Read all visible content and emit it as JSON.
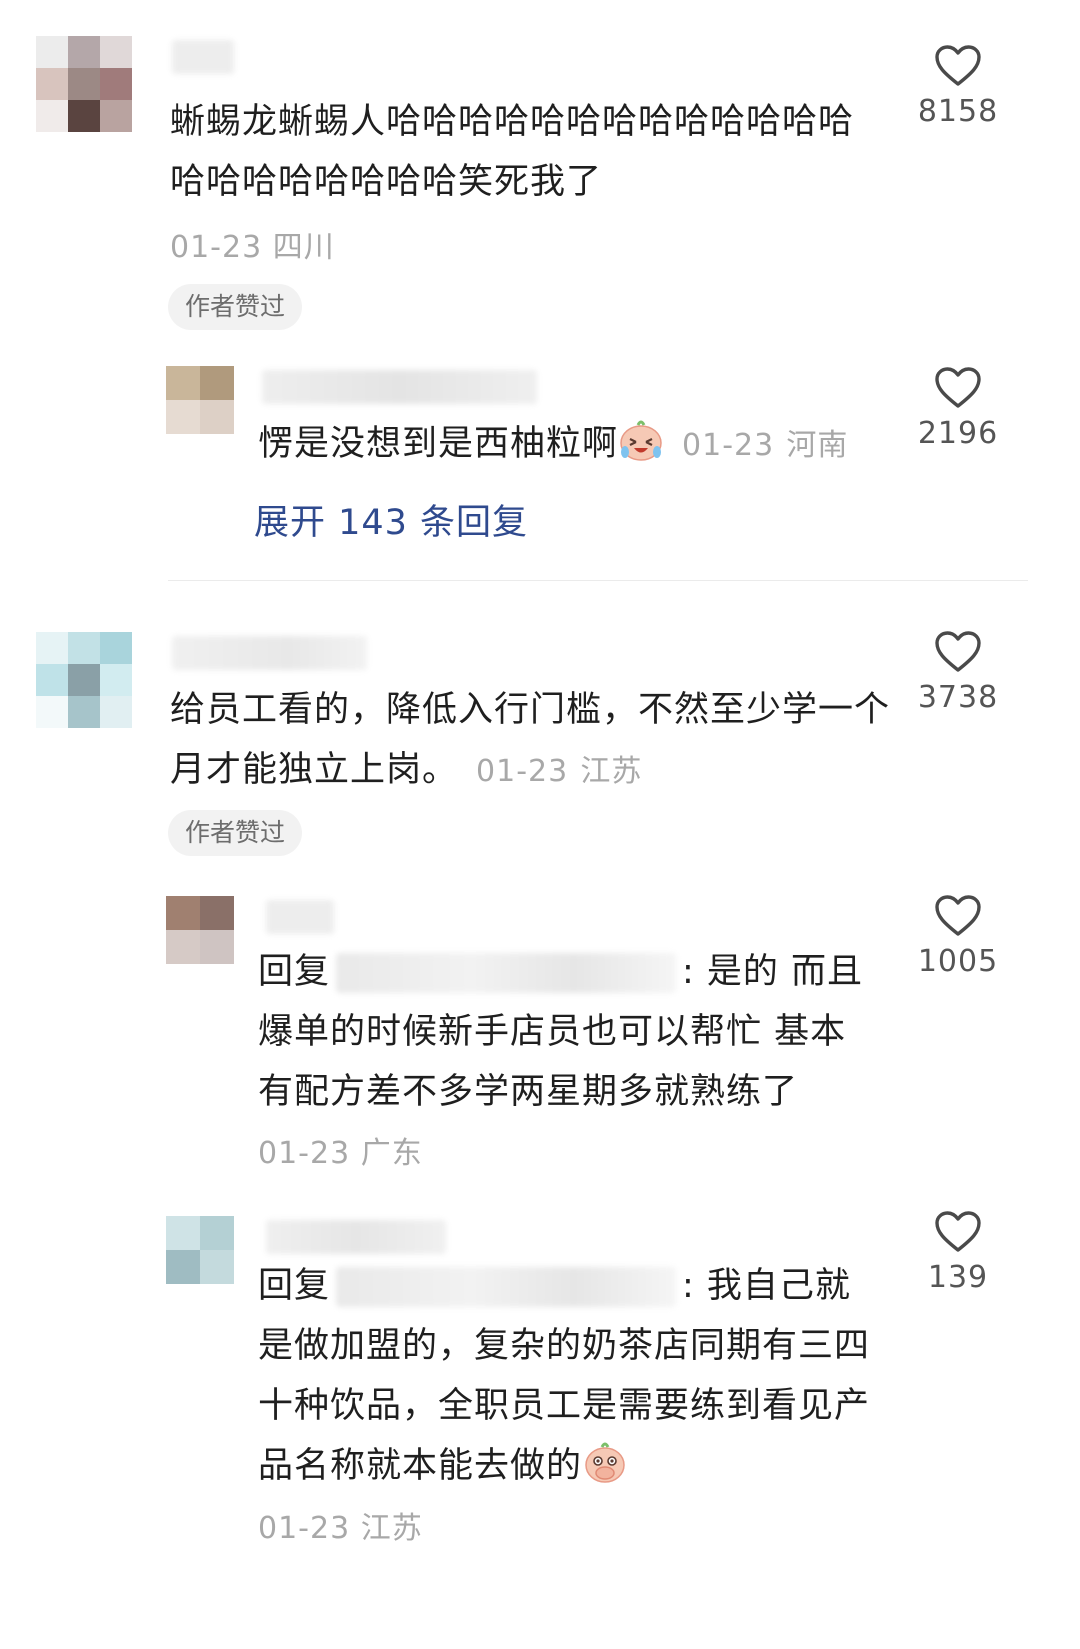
{
  "comments": [
    {
      "text": "蜥蜴龙蜥蜴人哈哈哈哈哈哈哈哈哈哈哈哈哈哈哈哈哈哈哈哈哈笑死我了",
      "date": "01-23",
      "location": "四川",
      "badge": "作者赞过",
      "likes": "8158",
      "reply": {
        "text": "愣是没想到是西柚粒啊",
        "emoji": "laughing-crying-emoji",
        "date": "01-23",
        "location": "河南",
        "likes": "2196"
      },
      "expand_label": "展开 143 条回复"
    },
    {
      "text": "给员工看的，降低入行门槛，不然至少学一个月才能独立上岗。",
      "date": "01-23",
      "location": "江苏",
      "badge": "作者赞过",
      "likes": "3738",
      "replies": [
        {
          "prefix": "回复",
          "text": ": 是的 而且爆单的时候新手店员也可以帮忙 基本有配方差不多学两星期多就熟练了",
          "date": "01-23",
          "location": "广东",
          "likes": "1005"
        },
        {
          "prefix": "回复",
          "text": ": 我自己就是做加盟的，复杂的奶茶店同期有三四十种饮品，全职员工是需要练到看见产品名称就本能去做的",
          "emoji": "covering-mouth-emoji",
          "date": "01-23",
          "location": "江苏",
          "likes": "139"
        }
      ]
    }
  ],
  "colors": {
    "text": "#1f1f1f",
    "meta": "#a8a8a8",
    "link": "#2f4a8e",
    "badge_bg": "#f2f2f2"
  }
}
